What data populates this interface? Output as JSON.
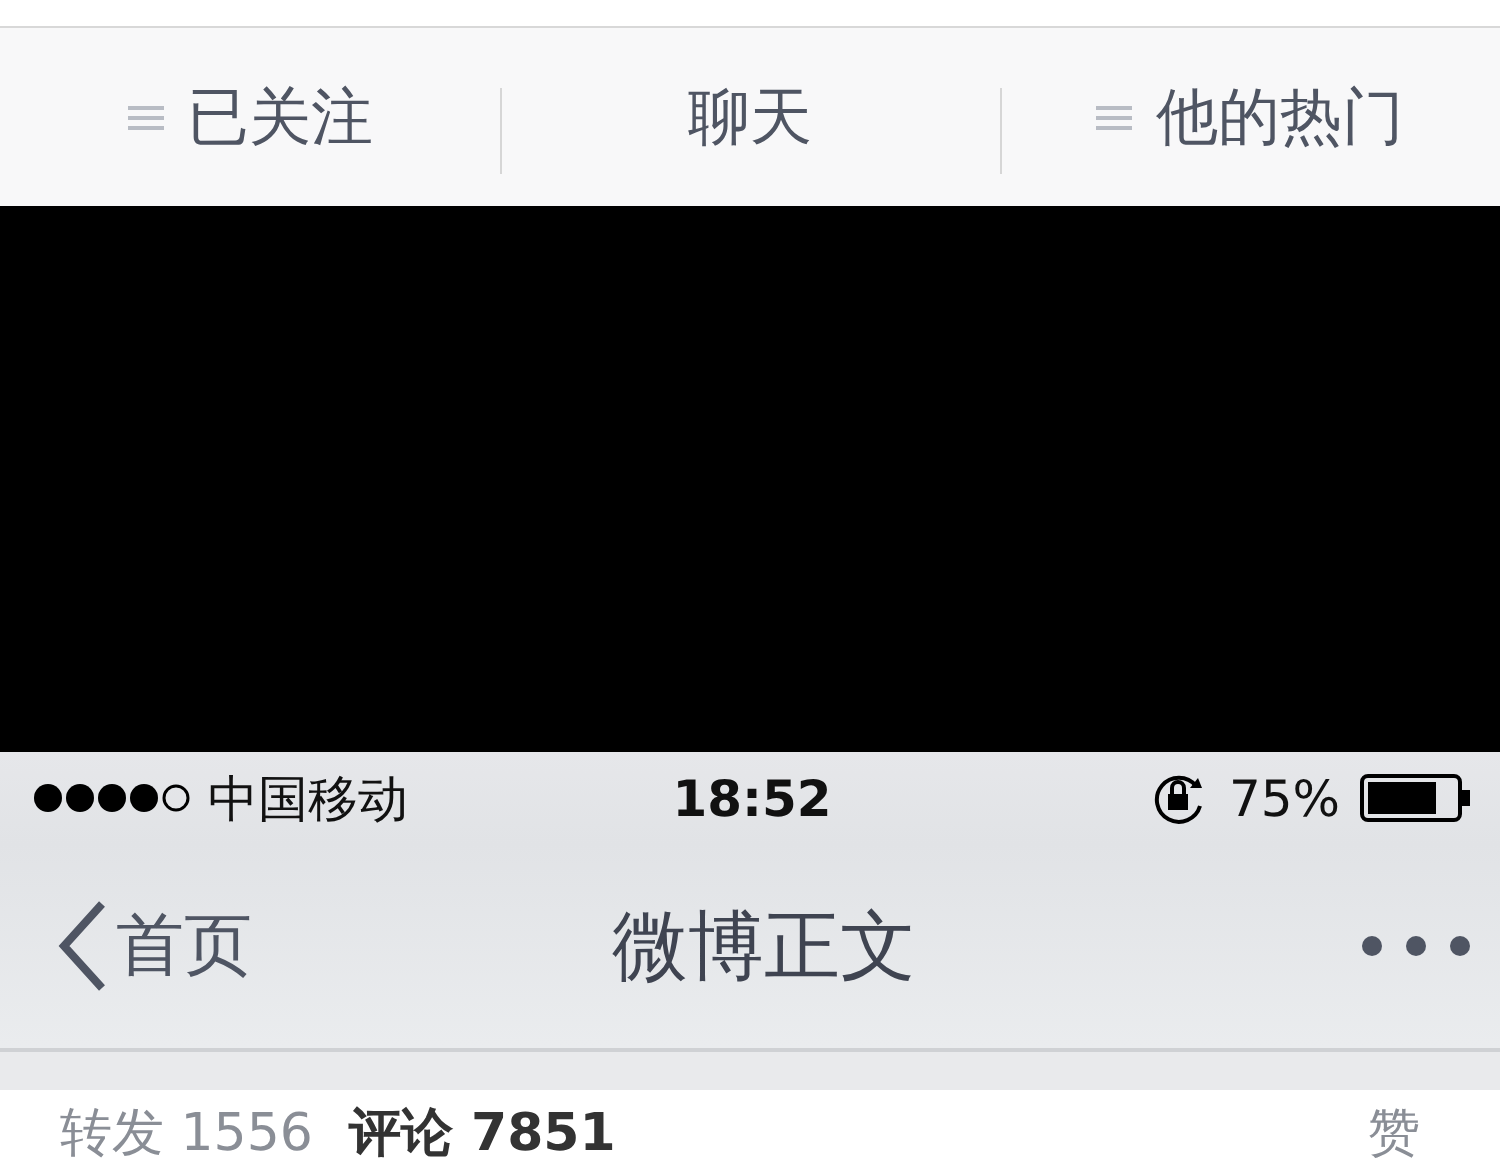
{
  "profile_tabs": [
    {
      "label": "已关注",
      "kind": "menu"
    },
    {
      "label": "聊天",
      "kind": "plain"
    },
    {
      "label": "他的热门",
      "kind": "menu"
    }
  ],
  "status_bar": {
    "carrier": "中国移动",
    "time": "18:52",
    "battery": "75%"
  },
  "nav_bar": {
    "back": "首页",
    "title": "微博正文"
  },
  "stats": [
    {
      "label": "转发",
      "count": "1556"
    },
    {
      "label": "评论",
      "count": "7851"
    }
  ],
  "like": "赞"
}
